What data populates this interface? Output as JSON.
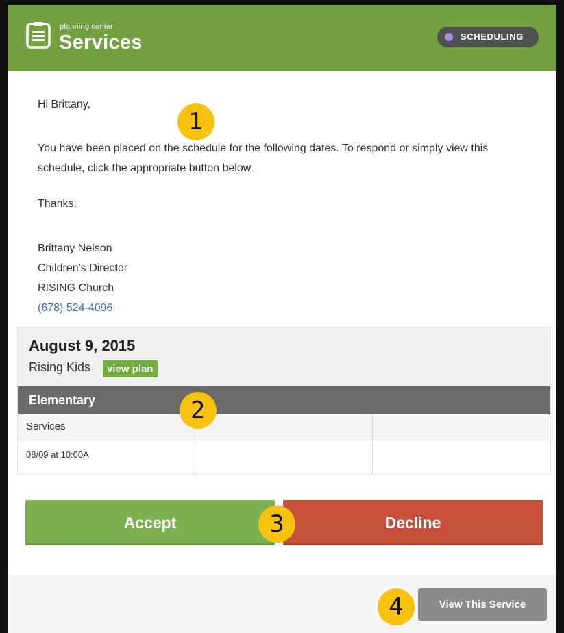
{
  "header": {
    "logo_small": "planning center",
    "logo_big": "Services",
    "badge_label": "SCHEDULING",
    "brand_color": "#74a140",
    "badge_dot_color": "#a28ce0"
  },
  "message": {
    "greeting": "Hi Brittany,",
    "body": "You have been placed on the schedule for the following dates. To respond or simply view this schedule, click the appropriate button below.",
    "closing": "Thanks,",
    "signature": {
      "name": "Brittany Nelson",
      "title": "Children's Director",
      "org": "RISING Church",
      "phone": "(678) 524-4096"
    }
  },
  "event": {
    "date": "August 9, 2015",
    "service_type": "Rising Kids",
    "view_plan_label": "view plan",
    "team": "Elementary",
    "columns": [
      "Services",
      "",
      ""
    ],
    "rows": [
      [
        "08/09 at 10:00A",
        "",
        ""
      ]
    ]
  },
  "actions": {
    "accept_label": "Accept",
    "decline_label": "Decline",
    "accept_color": "#7db04e",
    "decline_color": "#c7503a"
  },
  "footer": {
    "view_service_label": "View This Service"
  },
  "callouts": [
    "1",
    "2",
    "3",
    "4"
  ]
}
